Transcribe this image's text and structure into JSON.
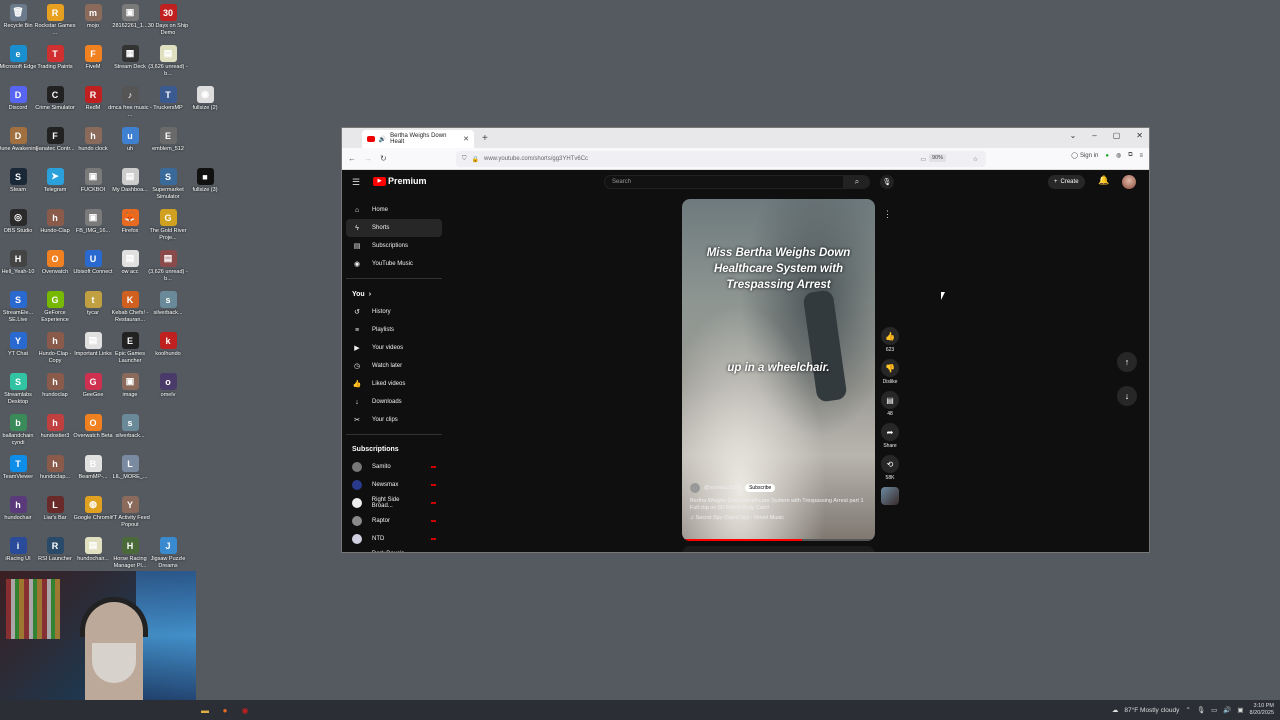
{
  "desktop": {
    "icons": [
      {
        "label": "Recycle Bin",
        "color": "#6b7b8c",
        "glyph": "🗑"
      },
      {
        "label": "Rockstar Games ...",
        "color": "#e8a020",
        "glyph": "R"
      },
      {
        "label": "mojo",
        "color": "#8a6a5a",
        "glyph": "m"
      },
      {
        "label": "28162261_1...",
        "color": "#7a7a7a",
        "glyph": "▣"
      },
      {
        "label": "30 Days on Ship Demo",
        "color": "#c02020",
        "glyph": "30"
      },
      {
        "label": "Microsoft Edge",
        "color": "#1a8fd0",
        "glyph": "e"
      },
      {
        "label": "Trading Paints",
        "color": "#d03030",
        "glyph": "T"
      },
      {
        "label": "FiveM",
        "color": "#f08020",
        "glyph": "F"
      },
      {
        "label": "Stream Deck",
        "color": "#333333",
        "glyph": "▦"
      },
      {
        "label": "(3,626 unread) - b...",
        "color": "#e0e0c0",
        "glyph": "▤"
      },
      {
        "label": "Discord",
        "color": "#5865f2",
        "glyph": "D"
      },
      {
        "label": "Crime Simulator",
        "color": "#222222",
        "glyph": "C"
      },
      {
        "label": "RedM",
        "color": "#c02020",
        "glyph": "R"
      },
      {
        "label": "dmca free music - ...",
        "color": "#555555",
        "glyph": "♪"
      },
      {
        "label": "TruckersMP",
        "color": "#3a5a90",
        "glyph": "T"
      },
      {
        "label": "fullsize (2)",
        "color": "#dddddd",
        "glyph": "◉"
      },
      {
        "label": "Dune Awakening",
        "color": "#a07040",
        "glyph": "D"
      },
      {
        "label": "Fanatec Contr...",
        "color": "#222222",
        "glyph": "F"
      },
      {
        "label": "hundo clock",
        "color": "#8a6a5a",
        "glyph": "h"
      },
      {
        "label": "uh",
        "color": "#4080d0",
        "glyph": "u"
      },
      {
        "label": "emblem_512",
        "color": "#6a6a6a",
        "glyph": "E"
      },
      {
        "label": "Steam",
        "color": "#1b2838",
        "glyph": "S"
      },
      {
        "label": "Telegram",
        "color": "#2aa1da",
        "glyph": "➤"
      },
      {
        "label": "FUCKBOI",
        "color": "#7a7a7a",
        "glyph": "▣"
      },
      {
        "label": "My Dashboa...",
        "color": "#cccccc",
        "glyph": "▤"
      },
      {
        "label": "Supermarket Simulator",
        "color": "#3a6a9a",
        "glyph": "S"
      },
      {
        "label": "fullsize (3)",
        "color": "#111111",
        "glyph": "■"
      },
      {
        "label": "OBS Studio",
        "color": "#2a2a2a",
        "glyph": "◎"
      },
      {
        "label": "Hundo-Clap",
        "color": "#8a5a4a",
        "glyph": "h"
      },
      {
        "label": "FB_IMG_16...",
        "color": "#7a7a7a",
        "glyph": "▣"
      },
      {
        "label": "Firefox",
        "color": "#e86a20",
        "glyph": "🦊"
      },
      {
        "label": "The Gold River Proje...",
        "color": "#d0a020",
        "glyph": "G"
      },
      {
        "label": "Hell_Yeah-10",
        "color": "#444444",
        "glyph": "H"
      },
      {
        "label": "Overwatch",
        "color": "#f08020",
        "glyph": "O"
      },
      {
        "label": "Ubisoft Connect",
        "color": "#2a6ad0",
        "glyph": "U"
      },
      {
        "label": "ow acc",
        "color": "#e0e0e0",
        "glyph": "▤"
      },
      {
        "label": "(3,626 unread) - b...",
        "color": "#8a4a4a",
        "glyph": "▤"
      },
      {
        "label": "StreamEle... SE.Live",
        "color": "#2a6ad0",
        "glyph": "S"
      },
      {
        "label": "GeForce Experience",
        "color": "#76b900",
        "glyph": "G"
      },
      {
        "label": "tycar",
        "color": "#c0a040",
        "glyph": "t"
      },
      {
        "label": "Kebab Chefs! - Restauran...",
        "color": "#d06020",
        "glyph": "K"
      },
      {
        "label": "silverback...",
        "color": "#6a8a9a",
        "glyph": "s"
      },
      {
        "label": "YT Chat",
        "color": "#2a6ad0",
        "glyph": "Y"
      },
      {
        "label": "Hundo-Clap - Copy",
        "color": "#8a5a4a",
        "glyph": "h"
      },
      {
        "label": "Important Links",
        "color": "#e0e0e0",
        "glyph": "▤"
      },
      {
        "label": "Epic Games Launcher",
        "color": "#222222",
        "glyph": "E"
      },
      {
        "label": "koolhundo",
        "color": "#c02020",
        "glyph": "k"
      },
      {
        "label": "Streamlabs Desktop",
        "color": "#31c3a2",
        "glyph": "S"
      },
      {
        "label": "hundoclap",
        "color": "#8a5a4a",
        "glyph": "h"
      },
      {
        "label": "GeeGee",
        "color": "#d03050",
        "glyph": "G"
      },
      {
        "label": "image",
        "color": "#8a6a5a",
        "glyph": "▣"
      },
      {
        "label": "omelv",
        "color": "#4a3a6a",
        "glyph": "o"
      },
      {
        "label": "ballandchain cyndi",
        "color": "#3a8a5a",
        "glyph": "b"
      },
      {
        "label": "hundostier3",
        "color": "#c04040",
        "glyph": "h"
      },
      {
        "label": "Overwatch Beta",
        "color": "#f08020",
        "glyph": "O"
      },
      {
        "label": "silverback...",
        "color": "#6a8a9a",
        "glyph": "s"
      },
      {
        "label": "TeamViewer",
        "color": "#0e8ee9",
        "glyph": "T"
      },
      {
        "label": "hundoclap...",
        "color": "#8a5a4a",
        "glyph": "h"
      },
      {
        "label": "BeamMP-...",
        "color": "#e0e0e0",
        "glyph": "B"
      },
      {
        "label": "LIL_MORE_...",
        "color": "#7a8aa0",
        "glyph": "L"
      },
      {
        "label": "hundochair",
        "color": "#5a3a7a",
        "glyph": "h"
      },
      {
        "label": "Liar's Bar",
        "color": "#6a2a2a",
        "glyph": "L"
      },
      {
        "label": "Google Chrome",
        "color": "#e0a020",
        "glyph": "◍"
      },
      {
        "label": "YT Activity Feed Popout",
        "color": "#8a6a5a",
        "glyph": "Y"
      },
      {
        "label": "iRacing UI",
        "color": "#2a4a9a",
        "glyph": "i"
      },
      {
        "label": "RSI Launcher",
        "color": "#2a4a6a",
        "glyph": "R"
      },
      {
        "label": "hundochair...",
        "color": "#e0e0c0",
        "glyph": "▤"
      },
      {
        "label": "Horse Racing Manager Pl...",
        "color": "#4a6a3a",
        "glyph": "H"
      },
      {
        "label": "Jigsaw Puzzle Dreams",
        "color": "#3a8ad0",
        "glyph": "J"
      }
    ]
  },
  "taskbar": {
    "apps": [
      {
        "name": "file-explorer",
        "glyph": "▬",
        "color": "#e0b040"
      },
      {
        "name": "firefox",
        "glyph": "●",
        "color": "#e86a20"
      },
      {
        "name": "obs",
        "glyph": "◉",
        "color": "#c02020"
      }
    ],
    "weather": "87°F  Mostly cloudy",
    "time": "3:10 PM",
    "date": "8/20/2025"
  },
  "browser": {
    "tab_title": "Bertha Weighs Down Healt",
    "url": "www.youtube.com/shorts/gg3YHTv6Cc",
    "zoom": "90%",
    "signin_label": "Sign in"
  },
  "youtube": {
    "brand": "Premium",
    "search_placeholder": "Search",
    "create_label": "Create",
    "nav": [
      {
        "label": "Home",
        "icon": "⌂"
      },
      {
        "label": "Shorts",
        "icon": "ϟ"
      },
      {
        "label": "Subscriptions",
        "icon": "▤"
      },
      {
        "label": "YouTube Music",
        "icon": "◉"
      }
    ],
    "you_header": "You",
    "you_items": [
      {
        "label": "History",
        "icon": "↺"
      },
      {
        "label": "Playlists",
        "icon": "≡"
      },
      {
        "label": "Your videos",
        "icon": "▶"
      },
      {
        "label": "Watch later",
        "icon": "◷"
      },
      {
        "label": "Liked videos",
        "icon": "👍"
      },
      {
        "label": "Downloads",
        "icon": "↓"
      },
      {
        "label": "Your clips",
        "icon": "✂"
      }
    ],
    "subs_header": "Subscriptions",
    "subscriptions": [
      {
        "label": "Samito",
        "color": "#777777"
      },
      {
        "label": "Newsmax",
        "color": "#2a3a8a"
      },
      {
        "label": "Right Side Broad...",
        "color": "#eeeeee"
      },
      {
        "label": "Raptor",
        "color": "#8a8a8a"
      },
      {
        "label": "NTD",
        "color": "#d0d0e0"
      },
      {
        "label": "Dark Dave's Mirror",
        "color": "#a06030"
      }
    ],
    "short": {
      "title": "Miss Bertha Weighs Down Healthcare System with Trespassing Arrest",
      "caption": "up in a wheelchair.",
      "channel": "@screenz1000",
      "subscribe_label": "Subscribe",
      "description": "Bertha Weighs Down Healthcare System with Trespassing Arrest part 1 Full clip on 50 Police Body Cam!",
      "music": "♫ Secret Spy (Sped Up) · Novel Music",
      "progress": 0.62
    },
    "actions": {
      "likes": "623",
      "dislike_label": "Dislike",
      "comments": "48",
      "share_label": "Share",
      "remix": "58K"
    }
  }
}
